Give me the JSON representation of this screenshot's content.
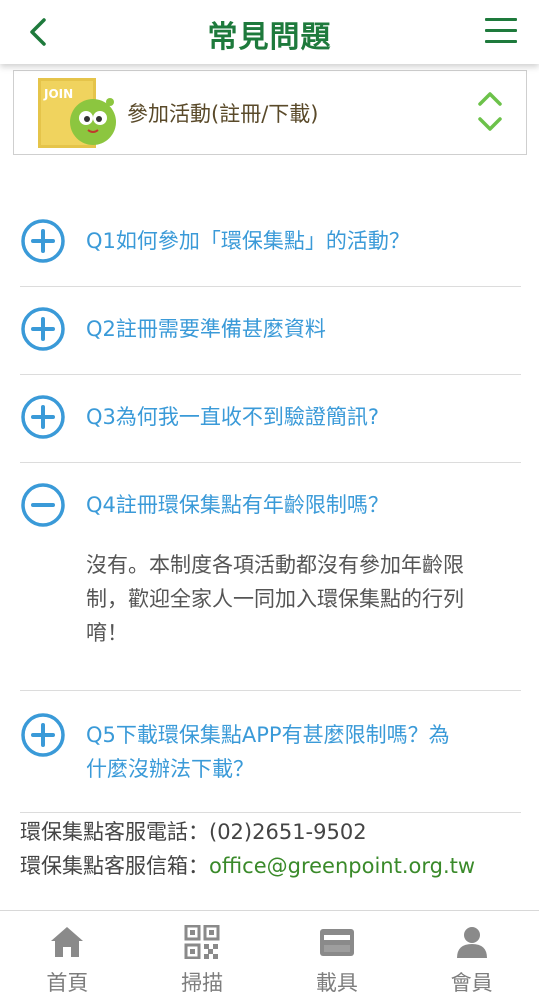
{
  "header": {
    "title": "常見問題"
  },
  "category": {
    "label": "參加活動(註冊/下載)",
    "image_text": "JOIN"
  },
  "faq": [
    {
      "question": "Q1如何參加「環保集點」的活動？",
      "expanded": false
    },
    {
      "question": "Q2註冊需要準備甚麼資料",
      "expanded": false
    },
    {
      "question": "Q3為何我一直收不到驗證簡訊?",
      "expanded": false
    },
    {
      "question": "Q4註冊環保集點有年齡限制嗎？",
      "expanded": true,
      "answer_lines": [
        "沒有。本制度各項活動都沒有參加年齡限",
        "制，歡迎全家人一同加入環保集點的行列",
        "唷！"
      ]
    },
    {
      "question_lines": [
        "Q5下載環保集點APP有甚麼限制嗎？為",
        "什麼沒辦法下載？"
      ],
      "expanded": false
    }
  ],
  "contact": {
    "phone_label": "環保集點客服電話：",
    "phone": "(02)2651-9502",
    "email_label": "環保集點客服信箱：",
    "email": "office@greenpoint.org.tw"
  },
  "bottom_nav": {
    "home": "首頁",
    "scan": "掃描",
    "carrier": "載具",
    "member": "會員"
  },
  "colors": {
    "brand_green": "#1e7a3c",
    "question_blue": "#3a9ad8",
    "email_green": "#3a8a2a"
  }
}
